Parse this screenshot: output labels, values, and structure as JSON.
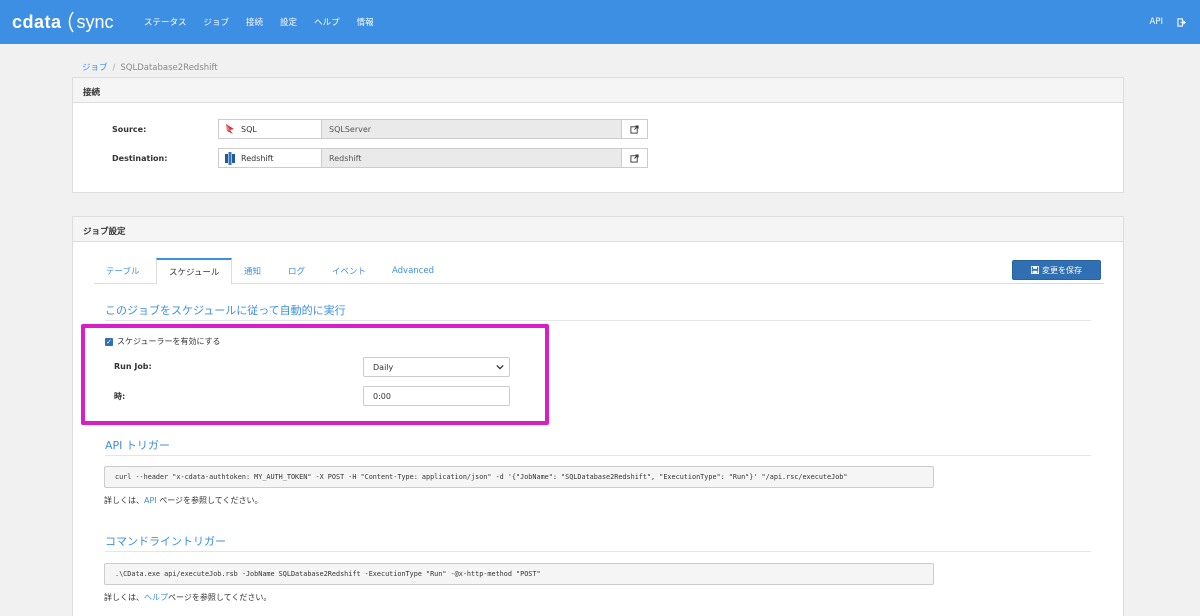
{
  "app": {
    "logo_left": "cdata",
    "logo_right": "sync",
    "nav": [
      "ステータス",
      "ジョブ",
      "接続",
      "設定",
      "ヘルプ",
      "情報"
    ],
    "api_label": "API",
    "logout_icon": "logout-icon"
  },
  "breadcrumb": {
    "parent": "ジョブ",
    "current": "SQLDatabase2Redshift"
  },
  "connections": {
    "title": "接続",
    "source": {
      "label": "Source:",
      "name": "SQL",
      "value": "SQLServer",
      "icon": "sql-server-icon"
    },
    "destination": {
      "label": "Destination:",
      "name": "Redshift",
      "value": "Redshift",
      "icon": "redshift-icon"
    }
  },
  "job_settings": {
    "title": "ジョブ設定",
    "tabs": [
      "テーブル",
      "スケジュール",
      "通知",
      "ログ",
      "イベント",
      "Advanced"
    ],
    "active_tab": "スケジュール",
    "save_label": "変更を保存"
  },
  "schedule": {
    "heading": "このジョブをスケジュールに従って自動的に実行",
    "enable_label": "スケジューラーを有効にする",
    "enabled": true,
    "run_job_label": "Run Job:",
    "run_job_value": "Daily",
    "time_label": "時:",
    "time_value": "0:00"
  },
  "api_trigger": {
    "heading": "API トリガー",
    "command": "curl --header \"x-cdata-authtoken: MY_AUTH_TOKEN\" -X POST -H \"Content-Type: application/json\" -d '{\"JobName\": \"SQLDatabase2Redshift\", \"ExecutionType\": \"Run\"}' \"/api.rsc/executeJob\"",
    "note_prefix": "詳しくは、",
    "note_link": "API",
    "note_suffix": " ページを参照してください。"
  },
  "cli_trigger": {
    "heading": "コマンドライントリガー",
    "command": ".\\CData.exe api/executeJob.rsb -JobName SQLDatabase2Redshift -ExecutionType \"Run\" -@x-http-method \"POST\"",
    "note_prefix": "詳しくは、",
    "note_link": "ヘルプ",
    "note_suffix": "ページを参照してください。"
  },
  "colors": {
    "accent": "#3d8fe4",
    "highlight": "#d91ec4",
    "button": "#2f6fb2"
  }
}
